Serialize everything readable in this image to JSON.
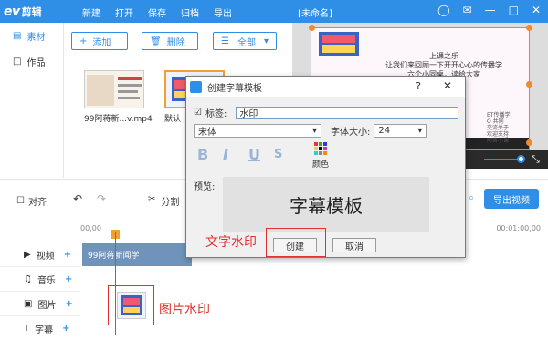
{
  "app": {
    "logo_ev": "ev",
    "logo_cn": "剪辑",
    "document_title": "[未命名]"
  },
  "menu": [
    "新建",
    "打开",
    "保存",
    "归档",
    "导出"
  ],
  "sidebar": {
    "items": [
      {
        "label": "素材",
        "icon": "folder-plus-icon",
        "active": true
      },
      {
        "label": "作品",
        "icon": "folder-icon",
        "active": false
      }
    ]
  },
  "toolbar": {
    "add_label": "添加",
    "delete_label": "删除",
    "filter_selected": "全部"
  },
  "media": [
    {
      "caption": "99阿蒋新...v.mp4"
    },
    {
      "caption": "默认"
    }
  ],
  "preview": {
    "line1": "上课之乐",
    "line2": "让我们来回顾一下开开心心的传播学",
    "line3": "六个小同桌，读给大家",
    "footer": "ET传播学\nQ 共同\n交流关于\n欢迎支持\n阿蒋小课"
  },
  "timeline": {
    "align_label": "对齐",
    "split_label": "分割",
    "export_label": "导出视频",
    "ruler_start": "00,00",
    "ruler_end": "00:01:00,00",
    "clip_label": "99阿蒋新闻学",
    "tracks": [
      {
        "label": "视频",
        "icon": "video-icon"
      },
      {
        "label": "音乐",
        "icon": "music-icon"
      },
      {
        "label": "图片",
        "icon": "image-icon"
      },
      {
        "label": "字幕",
        "icon": "text-icon"
      }
    ]
  },
  "dialog": {
    "title": "创建字幕模板",
    "help": "?",
    "tag_label": "标签:",
    "tag_value": "水印",
    "font_value": "宋体",
    "font_size_label": "字体大小:",
    "font_size_value": "24",
    "style_bold": "B",
    "style_italic": "I",
    "style_underline": "U",
    "style_strike": "S",
    "color_label": "颜色",
    "preview_label": "预览:",
    "preview_text": "字幕模板",
    "create_label": "创建",
    "cancel_label": "取消"
  },
  "annotations": {
    "text_watermark": "文字水印",
    "image_watermark": "图片水印"
  },
  "colors": {
    "accent": "#2f8ee6",
    "annotation": "#e03030"
  }
}
